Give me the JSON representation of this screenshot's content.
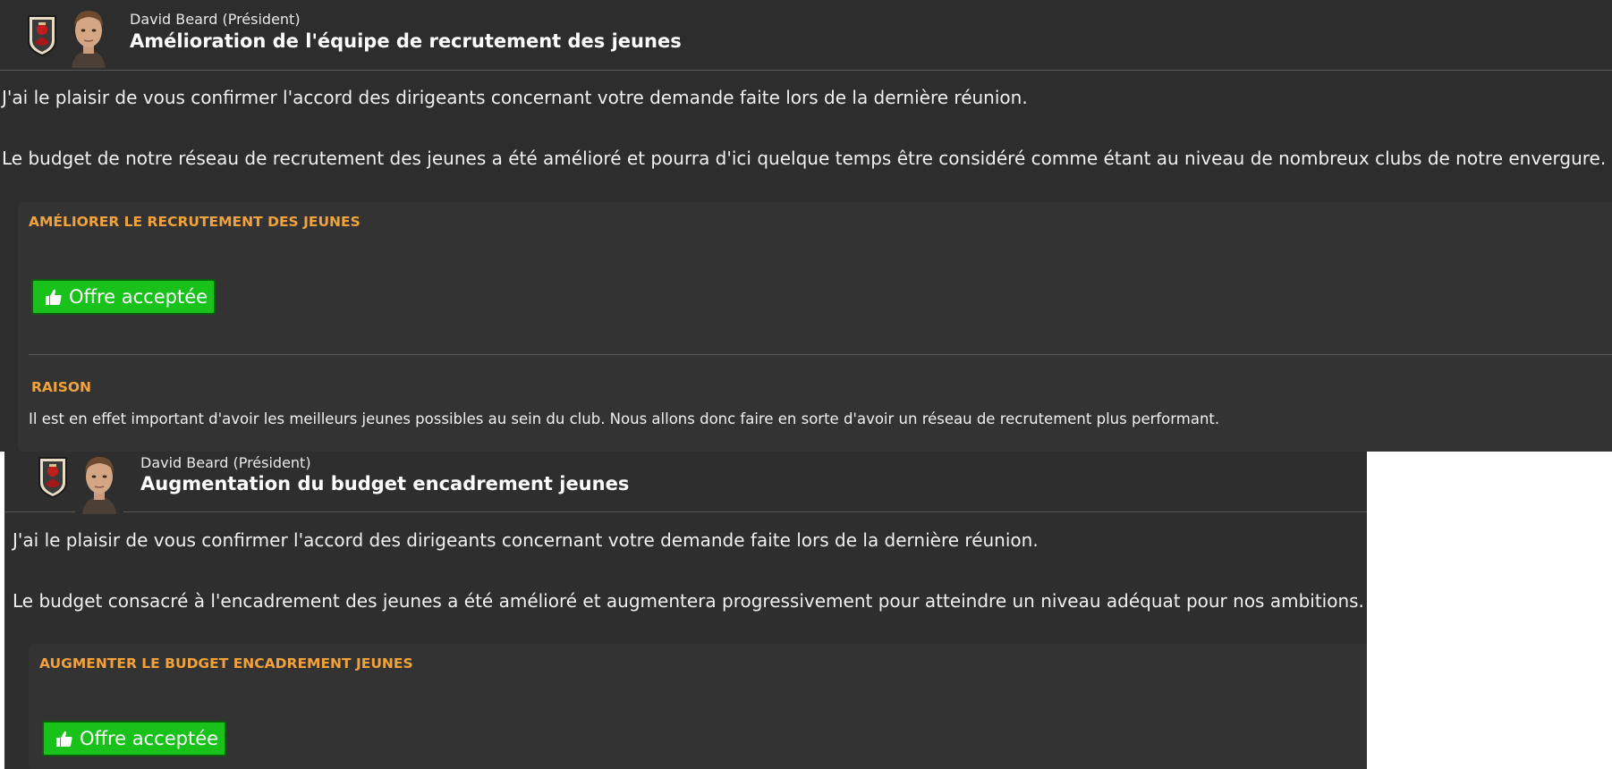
{
  "messages": [
    {
      "sender": "David Beard",
      "role": "(Président)",
      "title": "Amélioration de l'équipe de recrutement des jeunes",
      "paragraph1": "J'ai le plaisir de vous confirmer l'accord des dirigeants concernant votre demande faite lors de la dernière réunion.",
      "paragraph2": "Le budget de notre réseau de recrutement des jeunes a été amélioré et pourra d'ici quelque temps être considéré comme étant au niveau de nombreux clubs de notre envergure.",
      "card_heading": "AMÉLIORER LE RECRUTEMENT DES JEUNES",
      "button_label": "Offre acceptée",
      "reason_heading": "RAISON",
      "reason_text": "Il est en effet important d'avoir les meilleurs jeunes possibles au sein du club. Nous allons donc faire en sorte d'avoir un réseau de recrutement plus performant."
    },
    {
      "sender": "David Beard",
      "role": "(Président)",
      "title": "Augmentation du budget encadrement jeunes",
      "paragraph1": "J'ai le plaisir de vous confirmer l'accord des dirigeants concernant votre demande faite lors de la dernière réunion.",
      "paragraph2": "Le budget consacré à l'encadrement des jeunes a été amélioré et augmentera progressivement pour atteindre un niveau adéquat pour nos ambitions.",
      "card_heading": "AUGMENTER LE BUDGET ENCADREMENT JEUNES",
      "button_label": "Offre acceptée"
    }
  ],
  "icons": {
    "club_badge": "club-crest-icon",
    "avatar": "president-avatar",
    "button_icon": "thumbs-up-icon"
  },
  "colors": {
    "accent_orange": "#f2a23a",
    "accept_green": "#19c21b",
    "panel_bg": "#2d2d2d"
  }
}
